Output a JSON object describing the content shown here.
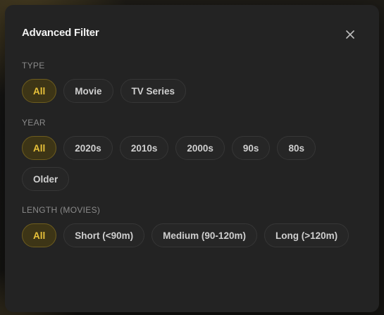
{
  "modal": {
    "title": "Advanced Filter",
    "close_icon": "close-icon"
  },
  "sections": {
    "type": {
      "label": "TYPE",
      "options": [
        "All",
        "Movie",
        "TV Series"
      ],
      "selected": "All"
    },
    "year": {
      "label": "YEAR",
      "options": [
        "All",
        "2020s",
        "2010s",
        "2000s",
        "90s",
        "80s",
        "Older"
      ],
      "selected": "All"
    },
    "length": {
      "label": "LENGTH (MOVIES)",
      "options": [
        "All",
        "Short (<90m)",
        "Medium (90-120m)",
        "Long (>120m)"
      ],
      "selected": "All"
    }
  },
  "colors": {
    "accent": "#e8c23a",
    "accent_bg": "#3d3516",
    "panel": "#232323"
  }
}
